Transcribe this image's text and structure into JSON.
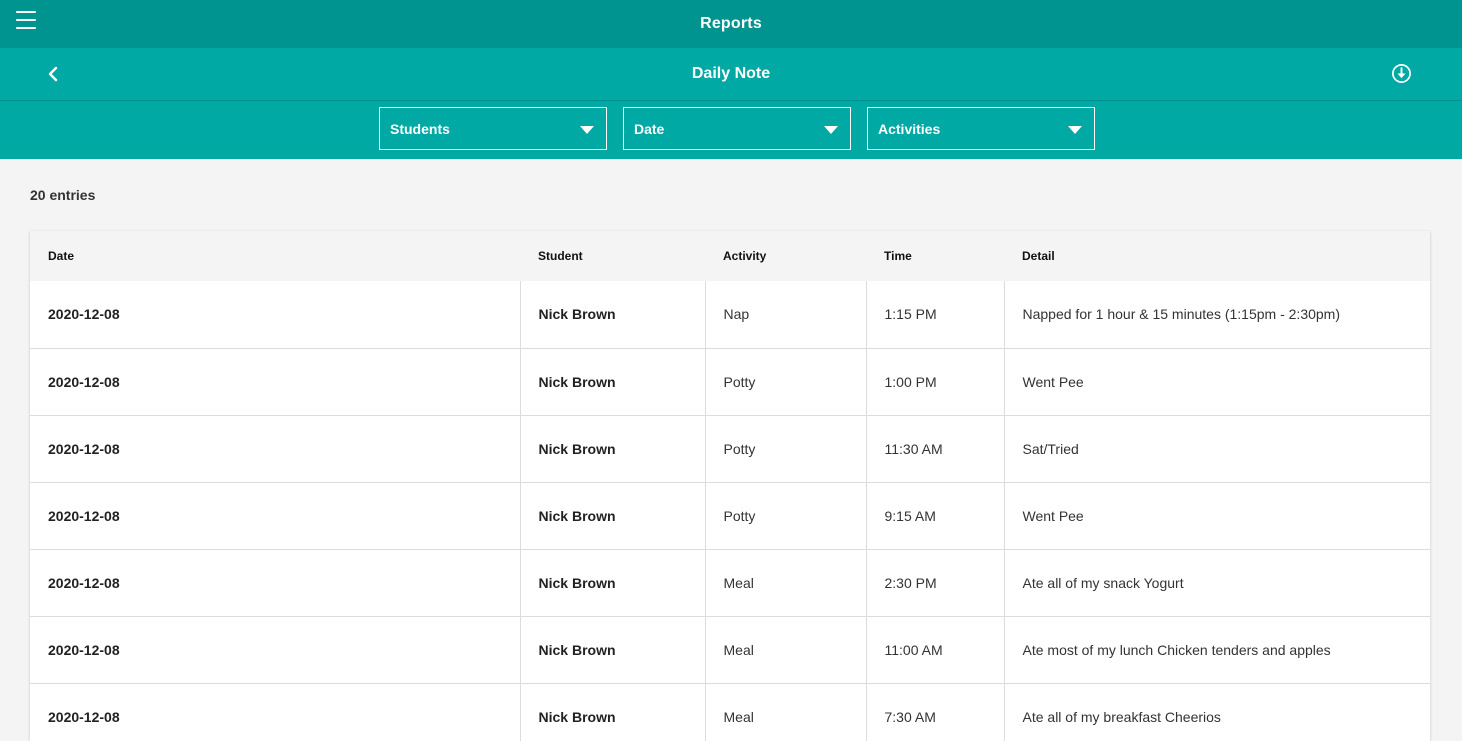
{
  "header": {
    "title": "Reports",
    "subtitle": "Daily Note"
  },
  "icons": {
    "menu": "menu-icon",
    "back": "back-icon",
    "download": "download-icon"
  },
  "filters": [
    {
      "label": "Students"
    },
    {
      "label": "Date"
    },
    {
      "label": "Activities"
    }
  ],
  "entries_label": "20 entries",
  "colors": {
    "topbar": "#009490",
    "subbar": "#00a9a4",
    "background": "#f4f4f4"
  },
  "table": {
    "columns": [
      "Date",
      "Student",
      "Activity",
      "Time",
      "Detail"
    ],
    "rows": [
      [
        "2020-12-08",
        "Nick Brown",
        "Nap",
        "1:15 PM",
        "Napped for 1 hour & 15 minutes (1:15pm - 2:30pm)"
      ],
      [
        "2020-12-08",
        "Nick Brown",
        "Potty",
        "1:00 PM",
        "Went Pee"
      ],
      [
        "2020-12-08",
        "Nick Brown",
        "Potty",
        "11:30 AM",
        "Sat/Tried"
      ],
      [
        "2020-12-08",
        "Nick Brown",
        "Potty",
        "9:15 AM",
        "Went Pee"
      ],
      [
        "2020-12-08",
        "Nick Brown",
        "Meal",
        "2:30 PM",
        "Ate all of my snack Yogurt"
      ],
      [
        "2020-12-08",
        "Nick Brown",
        "Meal",
        "11:00 AM",
        "Ate most of my lunch Chicken tenders and apples"
      ],
      [
        "2020-12-08",
        "Nick Brown",
        "Meal",
        "7:30 AM",
        "Ate all of my breakfast Cheerios"
      ]
    ]
  }
}
